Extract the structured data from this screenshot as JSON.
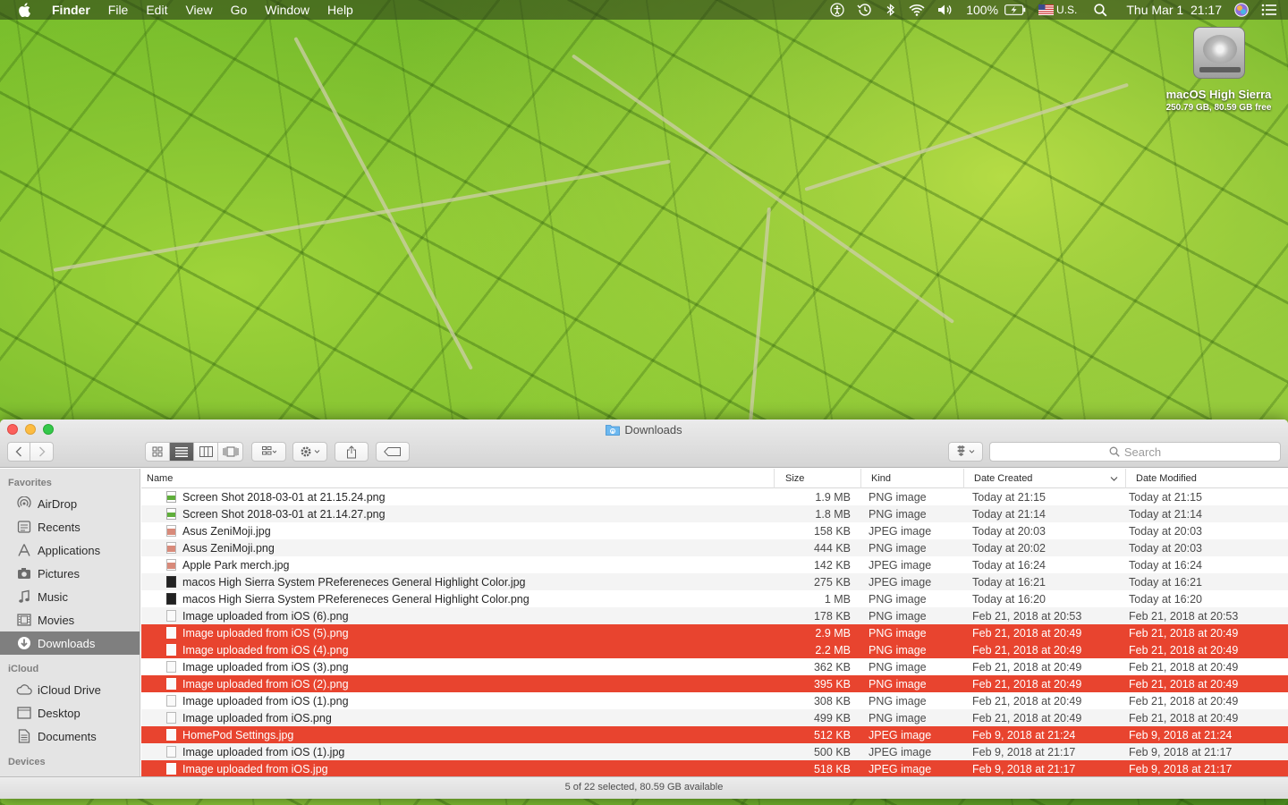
{
  "menubar": {
    "app_name": "Finder",
    "menus": [
      "File",
      "Edit",
      "View",
      "Go",
      "Window",
      "Help"
    ],
    "battery": "100%",
    "input_source": "U.S.",
    "clock": "Thu Mar 1  21:17"
  },
  "desktop": {
    "drive_name": "macOS High Sierra",
    "drive_info": "250.79 GB, 80.59 GB free"
  },
  "window": {
    "title": "Downloads",
    "search_placeholder": "Search",
    "status": "5 of 22 selected, 80.59 GB available"
  },
  "sidebar": {
    "favorites_header": "Favorites",
    "favorites": [
      {
        "label": "AirDrop",
        "icon": "airdrop-icon"
      },
      {
        "label": "Recents",
        "icon": "recents-icon"
      },
      {
        "label": "Applications",
        "icon": "applications-icon"
      },
      {
        "label": "Pictures",
        "icon": "pictures-icon"
      },
      {
        "label": "Music",
        "icon": "music-icon"
      },
      {
        "label": "Movies",
        "icon": "movies-icon"
      },
      {
        "label": "Downloads",
        "icon": "downloads-icon",
        "selected": true
      }
    ],
    "icloud_header": "iCloud",
    "icloud": [
      {
        "label": "iCloud Drive",
        "icon": "cloud-icon"
      },
      {
        "label": "Desktop",
        "icon": "desktop-icon"
      },
      {
        "label": "Documents",
        "icon": "documents-icon"
      }
    ],
    "devices_header": "Devices"
  },
  "columns": {
    "name": "Name",
    "size": "Size",
    "kind": "Kind",
    "date_created": "Date Created",
    "date_modified": "Date Modified"
  },
  "files": [
    {
      "name": "Screen Shot 2018-03-01 at 21.15.24.png",
      "size": "1.9 MB",
      "kind": "PNG image",
      "created": "Today at 21:15",
      "modified": "Today at 21:15",
      "selected": false,
      "icon": "png"
    },
    {
      "name": "Screen Shot 2018-03-01 at 21.14.27.png",
      "size": "1.8 MB",
      "kind": "PNG image",
      "created": "Today at 21:14",
      "modified": "Today at 21:14",
      "selected": false,
      "icon": "png"
    },
    {
      "name": "Asus ZeniMoji.jpg",
      "size": "158 KB",
      "kind": "JPEG image",
      "created": "Today at 20:03",
      "modified": "Today at 20:03",
      "selected": false,
      "icon": "jpg"
    },
    {
      "name": "Asus ZeniMoji.png",
      "size": "444 KB",
      "kind": "PNG image",
      "created": "Today at 20:02",
      "modified": "Today at 20:03",
      "selected": false,
      "icon": "jpg"
    },
    {
      "name": "Apple Park merch.jpg",
      "size": "142 KB",
      "kind": "JPEG image",
      "created": "Today at 16:24",
      "modified": "Today at 16:24",
      "selected": false,
      "icon": "jpg"
    },
    {
      "name": "macos High Sierra System PRefereneces General Highlight Color.jpg",
      "size": "275 KB",
      "kind": "JPEG image",
      "created": "Today at 16:21",
      "modified": "Today at 16:21",
      "selected": false,
      "icon": "dark"
    },
    {
      "name": "macos High Sierra System PRefereneces General Highlight Color.png",
      "size": "1 MB",
      "kind": "PNG image",
      "created": "Today at 16:20",
      "modified": "Today at 16:20",
      "selected": false,
      "icon": "dark"
    },
    {
      "name": "Image uploaded from iOS (6).png",
      "size": "178 KB",
      "kind": "PNG image",
      "created": "Feb 21, 2018 at 20:53",
      "modified": "Feb 21, 2018 at 20:53",
      "selected": false,
      "icon": "blank"
    },
    {
      "name": "Image uploaded from iOS (5).png",
      "size": "2.9 MB",
      "kind": "PNG image",
      "created": "Feb 21, 2018 at 20:49",
      "modified": "Feb 21, 2018 at 20:49",
      "selected": true,
      "icon": "blank"
    },
    {
      "name": "Image uploaded from iOS (4).png",
      "size": "2.2 MB",
      "kind": "PNG image",
      "created": "Feb 21, 2018 at 20:49",
      "modified": "Feb 21, 2018 at 20:49",
      "selected": true,
      "icon": "blank"
    },
    {
      "name": "Image uploaded from iOS (3).png",
      "size": "362 KB",
      "kind": "PNG image",
      "created": "Feb 21, 2018 at 20:49",
      "modified": "Feb 21, 2018 at 20:49",
      "selected": false,
      "icon": "blank"
    },
    {
      "name": "Image uploaded from iOS (2).png",
      "size": "395 KB",
      "kind": "PNG image",
      "created": "Feb 21, 2018 at 20:49",
      "modified": "Feb 21, 2018 at 20:49",
      "selected": true,
      "icon": "blank"
    },
    {
      "name": "Image uploaded from iOS (1).png",
      "size": "308 KB",
      "kind": "PNG image",
      "created": "Feb 21, 2018 at 20:49",
      "modified": "Feb 21, 2018 at 20:49",
      "selected": false,
      "icon": "blank"
    },
    {
      "name": "Image uploaded from iOS.png",
      "size": "499 KB",
      "kind": "PNG image",
      "created": "Feb 21, 2018 at 20:49",
      "modified": "Feb 21, 2018 at 20:49",
      "selected": false,
      "icon": "blank"
    },
    {
      "name": "HomePod Settings.jpg",
      "size": "512 KB",
      "kind": "JPEG image",
      "created": "Feb 9, 2018 at 21:24",
      "modified": "Feb 9, 2018 at 21:24",
      "selected": true,
      "icon": "blank"
    },
    {
      "name": "Image uploaded from iOS (1).jpg",
      "size": "500 KB",
      "kind": "JPEG image",
      "created": "Feb 9, 2018 at 21:17",
      "modified": "Feb 9, 2018 at 21:17",
      "selected": false,
      "icon": "blank"
    },
    {
      "name": "Image uploaded from iOS.jpg",
      "size": "518 KB",
      "kind": "JPEG image",
      "created": "Feb 9, 2018 at 21:17",
      "modified": "Feb 9, 2018 at 21:17",
      "selected": true,
      "icon": "blank"
    }
  ],
  "colors": {
    "selection": "#e8442f",
    "sidebar_selected": "#7f7f7f"
  }
}
